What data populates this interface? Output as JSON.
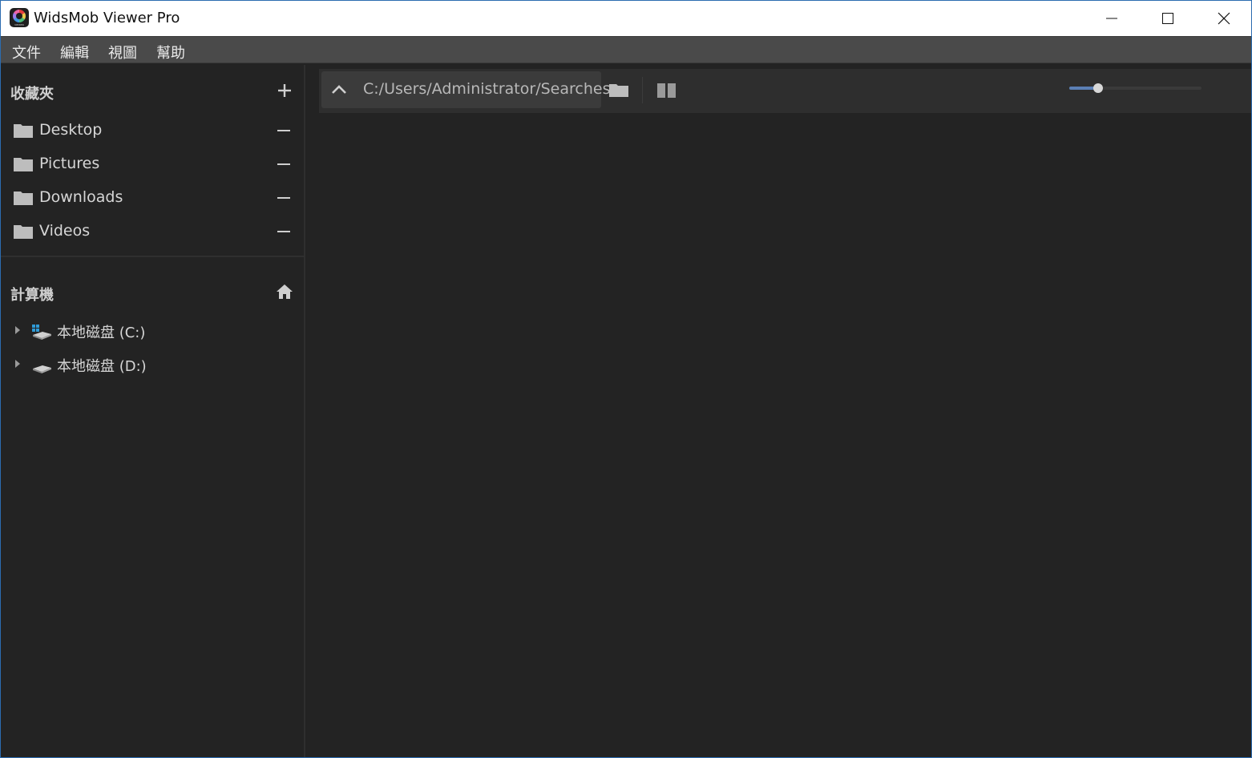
{
  "window": {
    "title": "WidsMob Viewer Pro",
    "icon_caption": "VIEWER"
  },
  "menu": [
    "文件",
    "編輯",
    "視圖",
    "幫助"
  ],
  "sidebar": {
    "favorites_title": "收藏夾",
    "favorites": [
      {
        "label": "Desktop",
        "icon": "folder-icon"
      },
      {
        "label": "Pictures",
        "icon": "folder-icon"
      },
      {
        "label": "Downloads",
        "icon": "folder-icon"
      },
      {
        "label": "Videos",
        "icon": "folder-icon"
      }
    ],
    "computer_title": "計算機",
    "drives": [
      {
        "label": "本地磁盘 (C:)",
        "icon": "system-drive-icon"
      },
      {
        "label": "本地磁盘 (D:)",
        "icon": "drive-icon"
      }
    ]
  },
  "toolbar": {
    "path": "C:/Users/Administrator/Searches",
    "thumbnail_size": 0.22
  },
  "colors": {
    "background": "#232323",
    "menubar": "#4a4a4a",
    "toolbar": "#2e2e2e",
    "accent": "#5b7fb5",
    "windows_blue": "#2f9ad6"
  }
}
